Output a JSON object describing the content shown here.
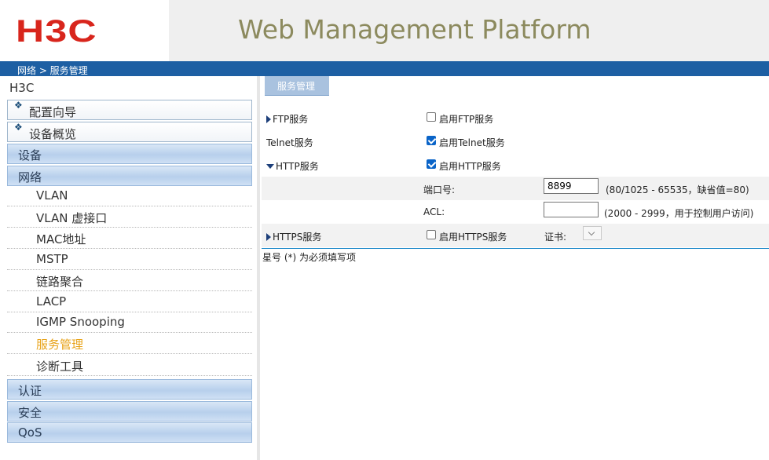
{
  "header": {
    "logo_text": "H3C",
    "title": "Web Management Platform"
  },
  "breadcrumb": "网络 > 服务管理",
  "sidebar": {
    "device_name": "H3C",
    "quick_items": [
      {
        "label": "配置向导"
      },
      {
        "label": "设备概览"
      }
    ],
    "categories": {
      "device": "设备",
      "network": "网络",
      "auth": "认证",
      "security": "安全",
      "qos": "QoS"
    },
    "network_items": [
      {
        "label": "VLAN"
      },
      {
        "label": "VLAN 虚接口"
      },
      {
        "label": "MAC地址"
      },
      {
        "label": "MSTP"
      },
      {
        "label": "链路聚合"
      },
      {
        "label": "LACP"
      },
      {
        "label": "IGMP Snooping"
      },
      {
        "label": "服务管理",
        "active": true
      },
      {
        "label": "诊断工具"
      }
    ]
  },
  "main": {
    "tab_label": "服务管理",
    "ftp": {
      "name": "FTP服务",
      "checkbox_label": "启用FTP服务",
      "checked": false
    },
    "telnet": {
      "name": "Telnet服务",
      "checkbox_label": "启用Telnet服务",
      "checked": true
    },
    "http": {
      "name": "HTTP服务",
      "checkbox_label": "启用HTTP服务",
      "checked": true,
      "port_label": "端口号:",
      "port_value": "8899",
      "port_hint": "(80/1025 - 65535，缺省值=80)",
      "acl_label": "ACL:",
      "acl_value": "",
      "acl_hint": "(2000 - 2999，用于控制用户访问)"
    },
    "https": {
      "name": "HTTPS服务",
      "checkbox_label": "启用HTTPS服务",
      "checked": false,
      "cert_label": "证书:"
    },
    "note": "星号 (*) 为必须填写项"
  },
  "colors": {
    "brand_red": "#d8251c",
    "breadcrumb_bar": "#1d5fa3",
    "active_item": "#e8a319",
    "checkbox_checked": "#0a64c8"
  }
}
